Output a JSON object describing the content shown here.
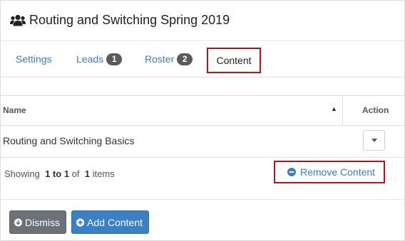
{
  "header": {
    "icon": "users-icon",
    "title": "Routing and Switching Spring 2019"
  },
  "tabs": [
    {
      "label": "Settings"
    },
    {
      "label": "Leads",
      "badge": "1"
    },
    {
      "label": "Roster",
      "badge": "2"
    },
    {
      "label": "Content",
      "active": true
    }
  ],
  "table": {
    "columns": [
      "Name",
      "Action"
    ],
    "sort_icon": "sort-asc-icon",
    "rows": [
      {
        "name": "Routing and Switching Basics"
      }
    ],
    "info": {
      "showing": "Showing",
      "from_to": "1 to 1",
      "of": "of",
      "total": "1",
      "items": "items"
    }
  },
  "action_menu": {
    "remove_label": "Remove Content",
    "icon": "minus-circle-icon"
  },
  "footer": {
    "dismiss_label": "Dismiss",
    "add_label": "Add Content"
  },
  "colors": {
    "link": "#3a7fc1",
    "highlight": "#b2141f",
    "dismiss": "#6b7177",
    "primary": "#3a80c4"
  }
}
